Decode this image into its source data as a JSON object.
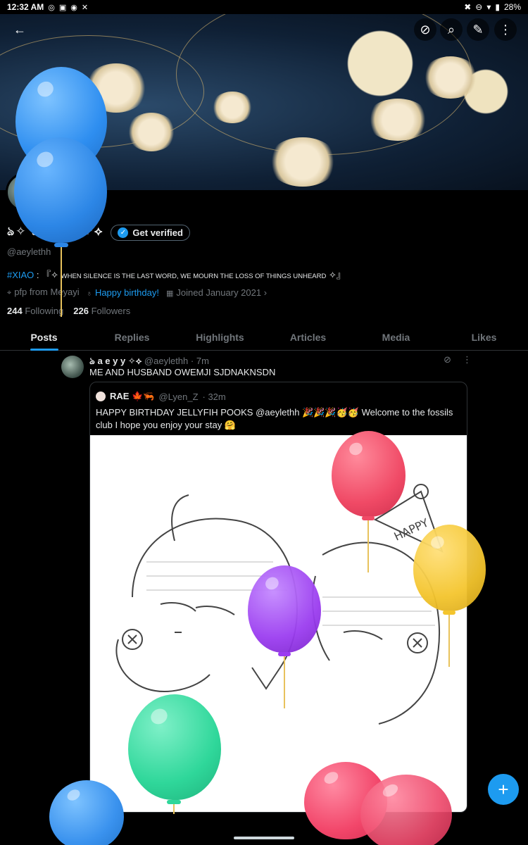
{
  "status_bar": {
    "time": "12:32 AM",
    "battery": "28%",
    "left_icons": [
      "whatsapp-icon",
      "instagram-icon",
      "discord-icon",
      "x-icon"
    ]
  },
  "profile": {
    "display_name": "ঌ✧ a e y y ✧⟡",
    "get_verified": "Get verified",
    "handle": "@aeylethh",
    "bio_tag": "#XIAO",
    "bio_rest": " : 『✧ ",
    "bio_caps": "WHEN SILENCE IS THE LAST WORD, WE MOURN THE LOSS OF THINGS UNHEARD",
    "bio_end": " ✧』",
    "location": "pfp from Meyayi",
    "birthday": "Happy birthday!",
    "joined": "Joined January 2021",
    "following_count": "244",
    "following_label": "Following",
    "followers_count": "226",
    "followers_label": "Followers"
  },
  "tabs": [
    "Posts",
    "Replies",
    "Highlights",
    "Articles",
    "Media",
    "Likes"
  ],
  "post": {
    "author": "ঌ a e y y ✧⟡",
    "handle": "@aeylethh",
    "time": "· 7m",
    "text": "ME AND HUSBAND OWEMJI SJDNAKNSDN",
    "quote": {
      "author": "RAE 🍁🦐",
      "handle": "@Lyen_Z",
      "time": "· 32m",
      "text": "HAPPY BIRTHDAY JELLYFIH POOKS  @aeylethh  🎉🎉🎉🥳🥳 Welcome to the fossils club I hope you enjoy your stay 🤗"
    }
  },
  "colors": {
    "accent": "#1d9bf0",
    "background": "#000000",
    "muted": "#71767b"
  }
}
